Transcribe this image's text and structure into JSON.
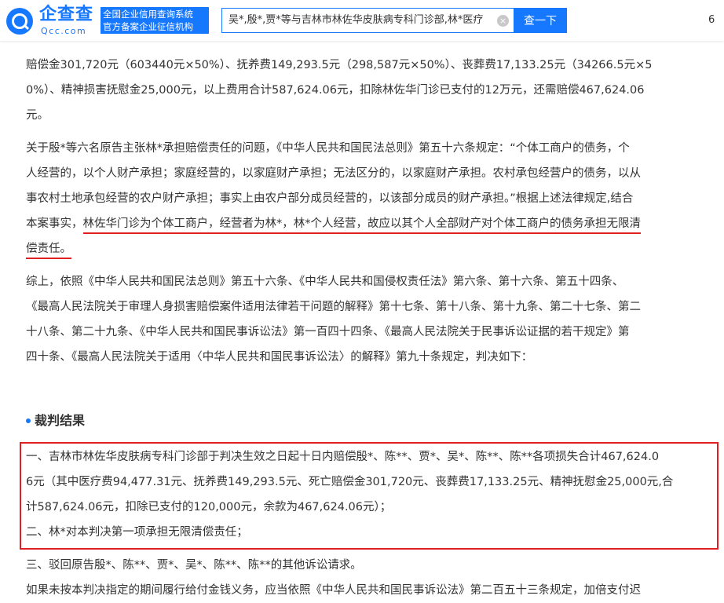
{
  "header": {
    "brand_name": "企查查",
    "brand_domain": "Qcc.com",
    "tagline_line1": "全国企业信用查询系统",
    "tagline_line2": "官方备案企业征信机构",
    "search_value": "吴*,殷*,贾*等与吉林市林佐华皮肤病专科门诊部,林*医疗",
    "search_button": "查一下",
    "more_text": "6"
  },
  "document": {
    "top_lines": [
      "赔偿金301,720元（603440元×50%）、抚养费149,293.5元（298,587元×50%）、丧葬费17,133.25元（34266.5元×5",
      "0%）、精神损害抚慰金25,000元，以上费用合计587,624.06元，扣除林佐华门诊已支付的12万元，还需赔偿467,624.06",
      "元。"
    ],
    "liability_lines": [
      "关于殷*等六名原告主张林*承担赔偿责任的问题，《中华人民共和国民法总则》第五十六条规定：“个体工商户的债务，个",
      "人经营的，以个人财产承担；家庭经营的，以家庭财产承担；无法区分的，以家庭财产承担。农村承包经营户的债务，以从",
      "事农村土地承包经营的农户财产承担；事实上由农户部分成员经营的，以该部分成员的财产承担。”根据上述法律规定,结合"
    ],
    "liability_line4_prefix": "本案事实，",
    "liability_line4_highlight": "林佐华门诊为个体工商户，经营者为林*，林*个人经营，故应以其个人全部财产对个体工商户的债务承担无限清",
    "liability_line5_highlight": "偿责任。",
    "summary_lines": [
      "综上，依照《中华人民共和国民法总则》第五十六条、《中华人民共和国侵权责任法》第六条、第十六条、第五十四条、",
      "《最高人民法院关于审理人身损害赔偿案件适用法律若干问题的解释》第十七条、第十八条、第十九条、第二十七条、第二",
      "十八条、第二十九条、《中华人民共和国民事诉讼法》第一百四十四条、《最高人民法院关于民事诉讼证据的若干规定》第",
      "四十条、《最高人民法院关于适用〈中华人民共和国民事诉讼法〉的解释》第九十条规定，判决如下："
    ],
    "section_title": "裁判结果",
    "judgment_lines": [
      "一、吉林市林佐华皮肤病专科门诊部于判决生效之日起十日内赔偿殷*、陈**、贾*、吴*、陈**、陈**各项损失合计467,624.0",
      "6元（其中医疗费94,477.31元、抚养费149,293.5元、死亡赔偿金301,720元、丧葬费17,133.25元、精神抚慰金25,000元,合",
      "计587,624.06元，扣除已支付的120,000元，余款为467,624.06元）；",
      "二、林*对本判决第一项承担无限清偿责任；"
    ],
    "after_lines": [
      "三、驳回原告殷*、陈**、贾*、吴*、陈**、陈**的其他诉讼请求。",
      "如果未按本判决指定的期间履行给付金钱义务，应当依照《中华人民共和国民事诉讼法》第二百五十三条规定，加倍支付迟"
    ]
  },
  "colors": {
    "brand_blue": "#1677ff",
    "highlight_red": "#e02020",
    "text": "#333333"
  }
}
